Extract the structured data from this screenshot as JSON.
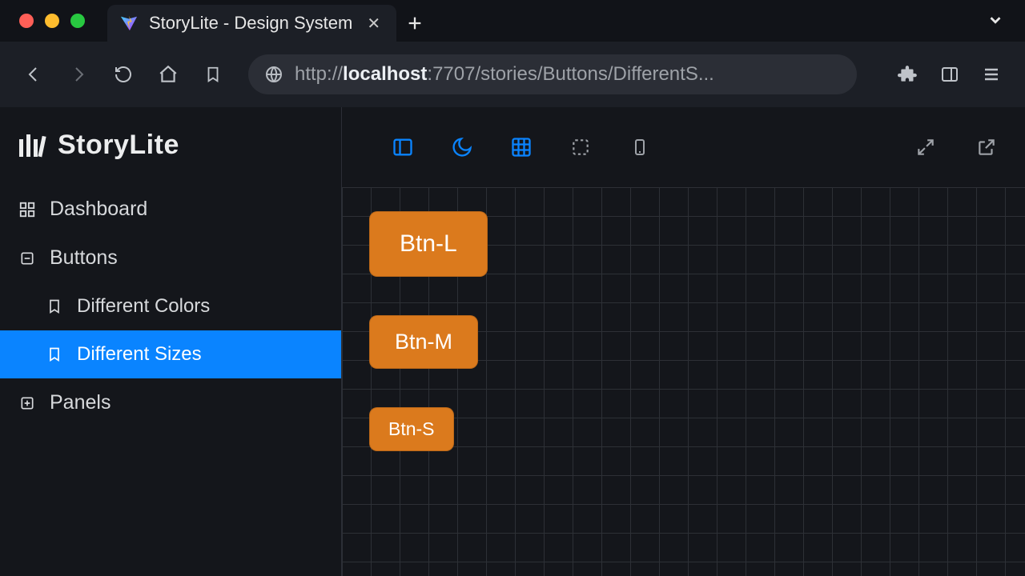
{
  "browser": {
    "tab_title": "StoryLite - Design System",
    "url_display_prefix": "http://",
    "url_display_host": "localhost",
    "url_display_rest": ":7707/stories/Buttons/DifferentS..."
  },
  "app": {
    "brand": "StoryLite",
    "sidebar": {
      "items": [
        {
          "label": "Dashboard",
          "icon": "dashboard-icon",
          "type": "item"
        },
        {
          "label": "Buttons",
          "icon": "collapse-icon",
          "type": "group"
        },
        {
          "label": "Different Colors",
          "icon": "bookmark-icon",
          "type": "sub",
          "active": false
        },
        {
          "label": "Different Sizes",
          "icon": "bookmark-icon",
          "type": "sub",
          "active": true
        },
        {
          "label": "Panels",
          "icon": "expand-icon",
          "type": "group"
        }
      ]
    }
  },
  "canvas": {
    "buttons": [
      {
        "label": "Btn-L",
        "size": "l"
      },
      {
        "label": "Btn-M",
        "size": "m"
      },
      {
        "label": "Btn-S",
        "size": "s"
      }
    ]
  },
  "colors": {
    "accent": "#0a84ff",
    "button_bg": "#db7a1d"
  }
}
